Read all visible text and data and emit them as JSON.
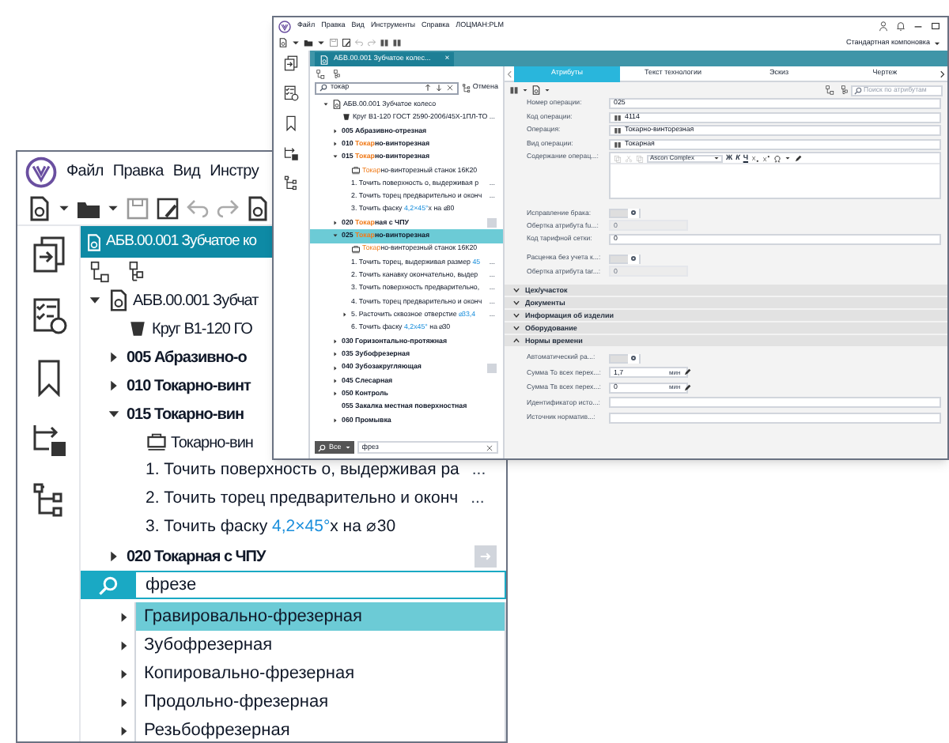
{
  "main_window": {
    "menu": [
      "Файл",
      "Правка",
      "Вид",
      "Инстру"
    ],
    "document_tab": {
      "label": "АБВ.00.001 Зубчатое ко",
      "selected": true
    },
    "tree": [
      {
        "kind": "document",
        "label": "АБВ.00.001 Зубчат",
        "expanded": true,
        "selected": false,
        "children": [
          {
            "kind": "material",
            "label": "Круг В1-120 ГО",
            "selected": false
          },
          {
            "kind": "operation",
            "label": "005 Абразивно-о",
            "expanded": false,
            "selected": false
          },
          {
            "kind": "operation",
            "label": "010 Токарно-винт",
            "expanded": false,
            "selected": false
          },
          {
            "kind": "operation",
            "label": "015 Токарно-вин",
            "expanded": true,
            "selected": false,
            "children": [
              {
                "kind": "machine",
                "label": "Токарно-вин",
                "selected": false
              },
              {
                "kind": "step",
                "parts": [
                  {
                    "text": "1. Точить поверхность о, выдерживая ра"
                  }
                ],
                "more": "...",
                "selected": false
              },
              {
                "kind": "step",
                "parts": [
                  {
                    "text": "2. Точить торец предварительно и оконч"
                  }
                ],
                "more": "...",
                "selected": false
              },
              {
                "kind": "step",
                "parts": [
                  {
                    "text": "3. Точить фаску "
                  },
                  {
                    "text": "4,2×45°",
                    "kind": "dimension"
                  },
                  {
                    "text": "x   на ⌀30"
                  }
                ],
                "selected": false
              }
            ]
          },
          {
            "kind": "operation",
            "label": "020 Токарная с ЧПУ",
            "expanded": false,
            "selected": false,
            "action": true
          }
        ]
      }
    ],
    "search": {
      "value": "фрезе"
    },
    "suggestions": [
      {
        "label": "Гравировально-фрезерная",
        "selected": true
      },
      {
        "label": "Зубофрезерная",
        "selected": false
      },
      {
        "label": "Копировально-фрезерная",
        "selected": false
      },
      {
        "label": "Продольно-фрезерная",
        "selected": false
      },
      {
        "label": "Резьбофрезерная",
        "selected": false
      }
    ]
  },
  "detail_window": {
    "menu": [
      "Файл",
      "Правка",
      "Вид",
      "Инструменты",
      "Справка",
      "ЛОЦМАН:PLM"
    ],
    "layout": "Стандартная компоновка",
    "document_tab": {
      "label": "АБВ.00.001 Зубчатое колес...",
      "close": "×",
      "selected": true
    },
    "tree_search": {
      "value": "токар",
      "cancel": "Отмена"
    },
    "tree": [
      {
        "kind": "document",
        "parts": [
          {
            "text": "АБВ.00.001 Зубчатое колесо"
          }
        ],
        "expanded": true,
        "selected": false,
        "children": [
          {
            "kind": "material",
            "parts": [
              {
                "text": "Круг В1-120 ГОСТ 2590-2006/45Х-1ПЛ-ТО"
              }
            ],
            "more": "...",
            "selected": false
          },
          {
            "kind": "operation",
            "parts": [
              {
                "text": "005 Абразивно-отрезная"
              }
            ],
            "expanded": false,
            "selected": false
          },
          {
            "kind": "operation",
            "parts": [
              {
                "text": "010 "
              },
              {
                "text": "Токар",
                "kind": "match"
              },
              {
                "text": "но-винторезная"
              }
            ],
            "expanded": false,
            "selected": false
          },
          {
            "kind": "operation",
            "parts": [
              {
                "text": "015 "
              },
              {
                "text": "Токар",
                "kind": "match"
              },
              {
                "text": "но-винторезная"
              }
            ],
            "expanded": true,
            "selected": false,
            "children": [
              {
                "kind": "machine",
                "parts": [
                  {
                    "text": "Токар",
                    "kind": "match"
                  },
                  {
                    "text": "но-винторезный станок 16К20"
                  }
                ],
                "selected": false
              },
              {
                "kind": "step",
                "parts": [
                  {
                    "text": "1. Точить поверхность о, выдерживая р"
                  }
                ],
                "more": "...",
                "selected": false
              },
              {
                "kind": "step",
                "parts": [
                  {
                    "text": "2. Точить торец предварительно и оконч"
                  }
                ],
                "more": "...",
                "selected": false
              },
              {
                "kind": "step",
                "parts": [
                  {
                    "text": "3. Точить фаску "
                  },
                  {
                    "text": "4,2×45°",
                    "kind": "dimension"
                  },
                  {
                    "text": "x  на ⌀30"
                  }
                ],
                "selected": false
              }
            ]
          },
          {
            "kind": "operation",
            "parts": [
              {
                "text": "020 "
              },
              {
                "text": "Токар",
                "kind": "match"
              },
              {
                "text": "ная с ЧПУ"
              }
            ],
            "expanded": false,
            "selected": false,
            "action": true
          },
          {
            "kind": "operation",
            "parts": [
              {
                "text": "025 "
              },
              {
                "text": "Токар",
                "kind": "match"
              },
              {
                "text": "но-винторезная"
              }
            ],
            "expanded": true,
            "selected": true,
            "children": [
              {
                "kind": "machine",
                "parts": [
                  {
                    "text": "Токар",
                    "kind": "match"
                  },
                  {
                    "text": "но-винторезный станок 16К20"
                  }
                ],
                "selected": false
              },
              {
                "kind": "step",
                "parts": [
                  {
                    "text": "1. Точить торец, выдерживая размер "
                  },
                  {
                    "text": "45",
                    "kind": "dimension"
                  }
                ],
                "more": "...",
                "selected": false
              },
              {
                "kind": "step",
                "parts": [
                  {
                    "text": "2. Точить канавку окончательно, выдер"
                  }
                ],
                "more": "...",
                "selected": false
              },
              {
                "kind": "step",
                "parts": [
                  {
                    "text": "3. Точить поверхность предварительно, "
                  }
                ],
                "more": "...",
                "selected": false
              },
              {
                "kind": "step",
                "parts": [
                  {
                    "text": "4. Точить торец предварительно и оконч"
                  }
                ],
                "more": "...",
                "selected": false
              },
              {
                "kind": "step",
                "parts": [
                  {
                    "text": "5. Расточить сквозное отверстие "
                  },
                  {
                    "text": "⌀33,4",
                    "kind": "dimension"
                  }
                ],
                "more": "...",
                "expanded": false,
                "selected": false
              },
              {
                "kind": "step",
                "parts": [
                  {
                    "text": "6. Точить фаску "
                  },
                  {
                    "text": "4,2х45°",
                    "kind": "dimension"
                  },
                  {
                    "text": "  на ⌀30"
                  }
                ],
                "selected": false
              }
            ]
          },
          {
            "kind": "operation",
            "parts": [
              {
                "text": "030 Горизонтально-протяжная"
              }
            ],
            "expanded": false,
            "selected": false
          },
          {
            "kind": "operation",
            "parts": [
              {
                "text": "035 Зубофрезерная"
              }
            ],
            "expanded": false,
            "selected": false
          },
          {
            "kind": "operation",
            "parts": [
              {
                "text": "040 Зубозакругляющая"
              }
            ],
            "expanded": false,
            "selected": false,
            "action": true
          },
          {
            "kind": "operation",
            "parts": [
              {
                "text": "045 Слесарная"
              }
            ],
            "expanded": false,
            "selected": false
          },
          {
            "kind": "operation",
            "parts": [
              {
                "text": "050 Контроль"
              }
            ],
            "expanded": false,
            "selected": false
          },
          {
            "kind": "operation",
            "parts": [
              {
                "text": "055 Закалка местная поверхностная"
              }
            ],
            "selected": false
          },
          {
            "kind": "operation",
            "parts": [
              {
                "text": "060 Промывка"
              }
            ],
            "expanded": false,
            "selected": false
          }
        ]
      }
    ],
    "filter": {
      "scope": "Все",
      "value": "фрез"
    },
    "tabs": [
      {
        "label": "Атрибуты",
        "selected": true
      },
      {
        "label": "Текст технологии",
        "selected": false
      },
      {
        "label": "Эскиз",
        "selected": false
      },
      {
        "label": "Чертеж",
        "selected": false
      }
    ],
    "attribute_search": {
      "placeholder": "Поиск по атрибутам"
    },
    "fields": [
      {
        "kind": "text",
        "label": "Номер операции:",
        "value": "025"
      },
      {
        "kind": "lookup",
        "label": "Код операции:",
        "value": "4114"
      },
      {
        "kind": "lookup",
        "label": "Операция:",
        "value": "Токарно-винторезная"
      },
      {
        "kind": "lookup",
        "label": "Вид операции:",
        "value": "Токарная"
      },
      {
        "kind": "editor",
        "label": "Содержание операц...:",
        "font": "Ascon Complex",
        "buttons": [
          "Ж",
          "К",
          "Ч"
        ]
      },
      {
        "kind": "toggle",
        "label": "Исправление брака:",
        "on": false
      },
      {
        "kind": "text",
        "label": "Обертка атрибута fu...:",
        "value": "0",
        "disabled": true
      },
      {
        "kind": "text",
        "label": "Код тарифной сетки:",
        "value": "0",
        "disabled": false
      },
      {
        "kind": "toggle",
        "label": "Расценка без учета к...:",
        "on": false
      },
      {
        "kind": "text",
        "label": "Обертка атрибута tar...:",
        "value": "0",
        "disabled": true
      }
    ],
    "sections": [
      {
        "title": "Цех/участок",
        "expanded": false
      },
      {
        "title": "Документы",
        "expanded": false
      },
      {
        "title": "Информация об изделии",
        "expanded": false
      },
      {
        "title": "Оборудование",
        "expanded": false
      },
      {
        "title": "Нормы времени",
        "expanded": true,
        "fields": [
          {
            "kind": "toggle",
            "label": "Автоматический ра...:",
            "on": false
          },
          {
            "kind": "unit",
            "label": "Сумма То всех перех...:",
            "value": "1,7",
            "unit": "мин"
          },
          {
            "kind": "unit",
            "label": "Сумма Тв всех перех...:",
            "value": "0",
            "unit": "мин"
          },
          {
            "kind": "text",
            "label": "Идентификатор исто...:"
          },
          {
            "kind": "text",
            "label": "Источник норматив...:"
          }
        ]
      }
    ]
  }
}
